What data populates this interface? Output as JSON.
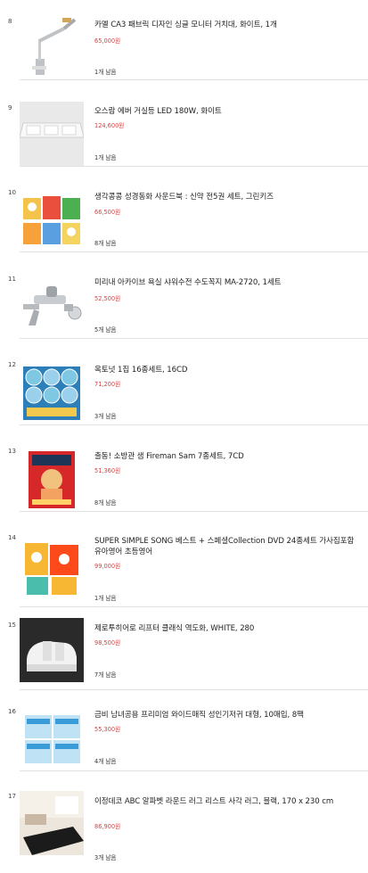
{
  "products": [
    {
      "rank": "8",
      "title": "카멜 CA3 패브릭 디자인 싱글 모니터 거치대, 화이트, 1개",
      "price": "65,000원",
      "stock": "1개 남음",
      "thumb": "monitor-arm"
    },
    {
      "rank": "9",
      "title": "오스람 에버 거실등 LED 180W, 화이트",
      "price": "124,600원",
      "stock": "1개 남음",
      "thumb": "ceiling-light"
    },
    {
      "rank": "10",
      "title": "생각콩콩 성경동화 사운드북 : 신약 전5권 세트, 그린키즈",
      "price": "66,500원",
      "stock": "8개 남음",
      "thumb": "books"
    },
    {
      "rank": "11",
      "title": "미리내 아카이브 욕실 샤워수전 수도꼭지 MA-2720, 1세트",
      "price": "52,500원",
      "stock": "5개 남음",
      "thumb": "faucet"
    },
    {
      "rank": "12",
      "title": "옥토넛 1집 16종세트, 16CD",
      "price": "71,200원",
      "stock": "3개 남음",
      "thumb": "cds"
    },
    {
      "rank": "13",
      "title": "출동! 소방관 샘 Fireman Sam 7종세트, 7CD",
      "price": "51,360원",
      "stock": "8개 남음",
      "thumb": "dvd-box"
    },
    {
      "rank": "14",
      "title": "SUPER SIMPLE SONG 베스트 + 스페셜Collection DVD 24종세트 가사집포함 유아영어 초등영어",
      "price": "99,000원",
      "stock": "1개 남음",
      "thumb": "dvd-set"
    },
    {
      "rank": "15",
      "title": "제로투히어로 리프터 클래식 역도화, WHITE, 280",
      "price": "98,500원",
      "stock": "7개 남음",
      "thumb": "shoe"
    },
    {
      "rank": "16",
      "title": "금비 남녀공용 프리미엄 와이드매직 성인기저귀 대형, 10매입, 8팩",
      "price": "55,300원",
      "stock": "4개 남음",
      "thumb": "diapers"
    },
    {
      "rank": "17",
      "title": "이정데코 ABC 알파벳 라운드 러그 리스트 사각 러그, 블랙, 170 x 230 cm",
      "price": "86,900원",
      "stock": "3개 남음",
      "thumb": "rug"
    }
  ]
}
